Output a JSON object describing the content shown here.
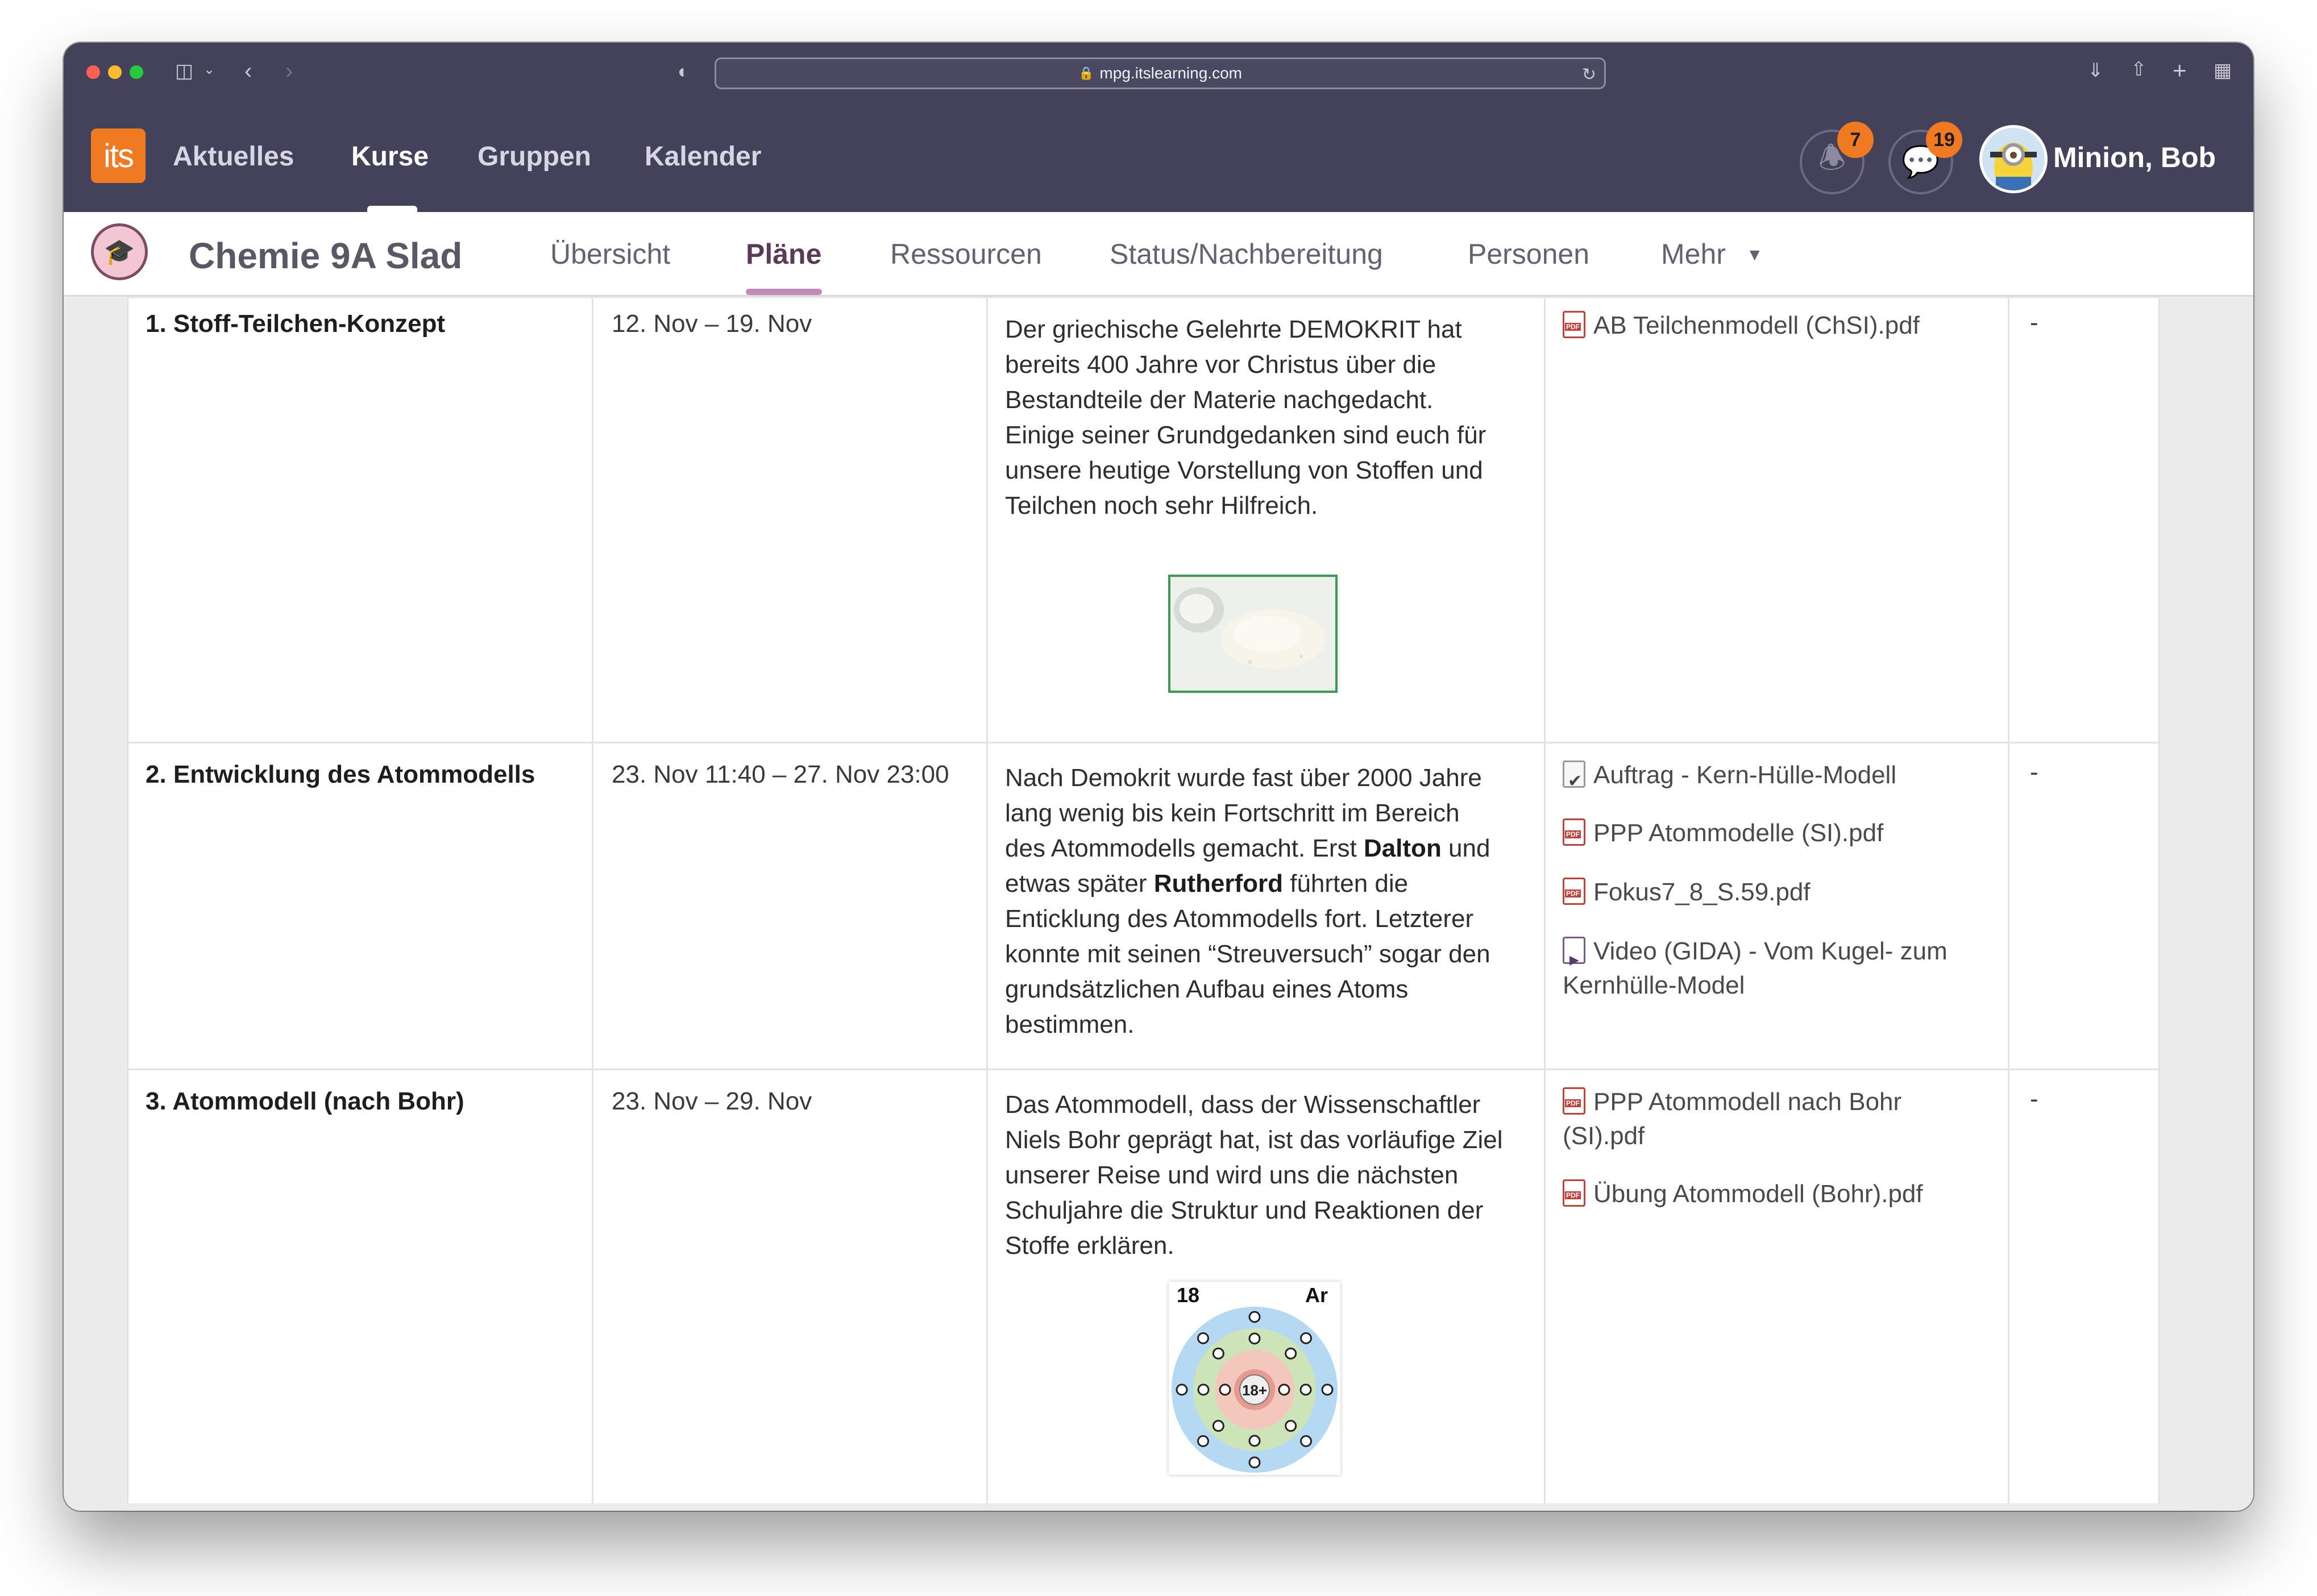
{
  "browser": {
    "url": "mpg.itslearning.com"
  },
  "topnav": {
    "logo": "its",
    "links": [
      "Aktuelles",
      "Kurse",
      "Gruppen",
      "Kalender"
    ],
    "active": "Kurse",
    "notifications_count": "7",
    "messages_count": "19",
    "user_name": "Minion, Bob"
  },
  "course": {
    "title": "Chemie 9A Slad",
    "tabs": [
      "Übersicht",
      "Pläne",
      "Ressourcen",
      "Status/Nachbereitung",
      "Personen",
      "Mehr"
    ],
    "active_tab": "Pläne"
  },
  "plans": [
    {
      "topic": "1. Stoff-Teilchen-Konzept",
      "date": "12. Nov – 19. Nov",
      "description_lines": [
        "Der griechische Gelehrte DEMOKRIT hat",
        "bereits 400 Jahre vor Christus über die",
        "Bestandteile der Materie nachgedacht.",
        "Einige seiner Grundgedanken sind euch für",
        "unsere heutige Vorstellung von Stoffen und",
        "Teilchen noch sehr Hilfreich."
      ],
      "resources": [
        "AB Teilchenmodell (ChSI).pdf"
      ],
      "status": "-"
    },
    {
      "topic": "2. Entwicklung des Atommodells",
      "date": "23. Nov 11:40 – 27. Nov 23:00",
      "description": {
        "l1": "Nach Demokrit wurde fast über 2000 Jahre",
        "l2": "lang wenig bis kein Fortschritt im Bereich",
        "l3a": "des Atommodells gemacht. Erst ",
        "l3b": "Dalton",
        "l3c": " und",
        "l4a": "etwas später ",
        "l4b": "Rutherford",
        "l4c": " führten die",
        "l5": "Enticklung des Atommodells fort. Letzterer",
        "l6": "konnte mit seinen “Streuversuch” sogar den",
        "l7": "grundsätzlichen Aufbau eines Atoms",
        "l8": "bestimmen."
      },
      "resources": [
        "Auftrag - Kern-Hülle-Modell",
        "PPP Atommodelle (SI).pdf",
        "Fokus7_8_S.59.pdf",
        "Video (GIDA) - Vom Kugel- zum",
        "Kernhülle-Model"
      ],
      "status": "-"
    },
    {
      "topic": "3. Atommodell (nach Bohr)",
      "date": "23. Nov – 29. Nov",
      "description_lines": [
        "Das Atommodell, dass der Wissenschaftler",
        "Niels Bohr geprägt hat, ist das vorläufige Ziel",
        "unserer Reise und wird uns die nächsten",
        "Schuljahre die Struktur und Reaktionen der",
        "Stoffe erklären."
      ],
      "resources": [
        "PPP Atommodell nach Bohr",
        "(SI).pdf",
        "Übung Atommodell (Bohr).pdf"
      ],
      "status": "-",
      "atom_image": {
        "number": "18",
        "symbol": "Ar",
        "nucleus": "18+",
        "shells": [
          2,
          8,
          8
        ]
      }
    }
  ]
}
